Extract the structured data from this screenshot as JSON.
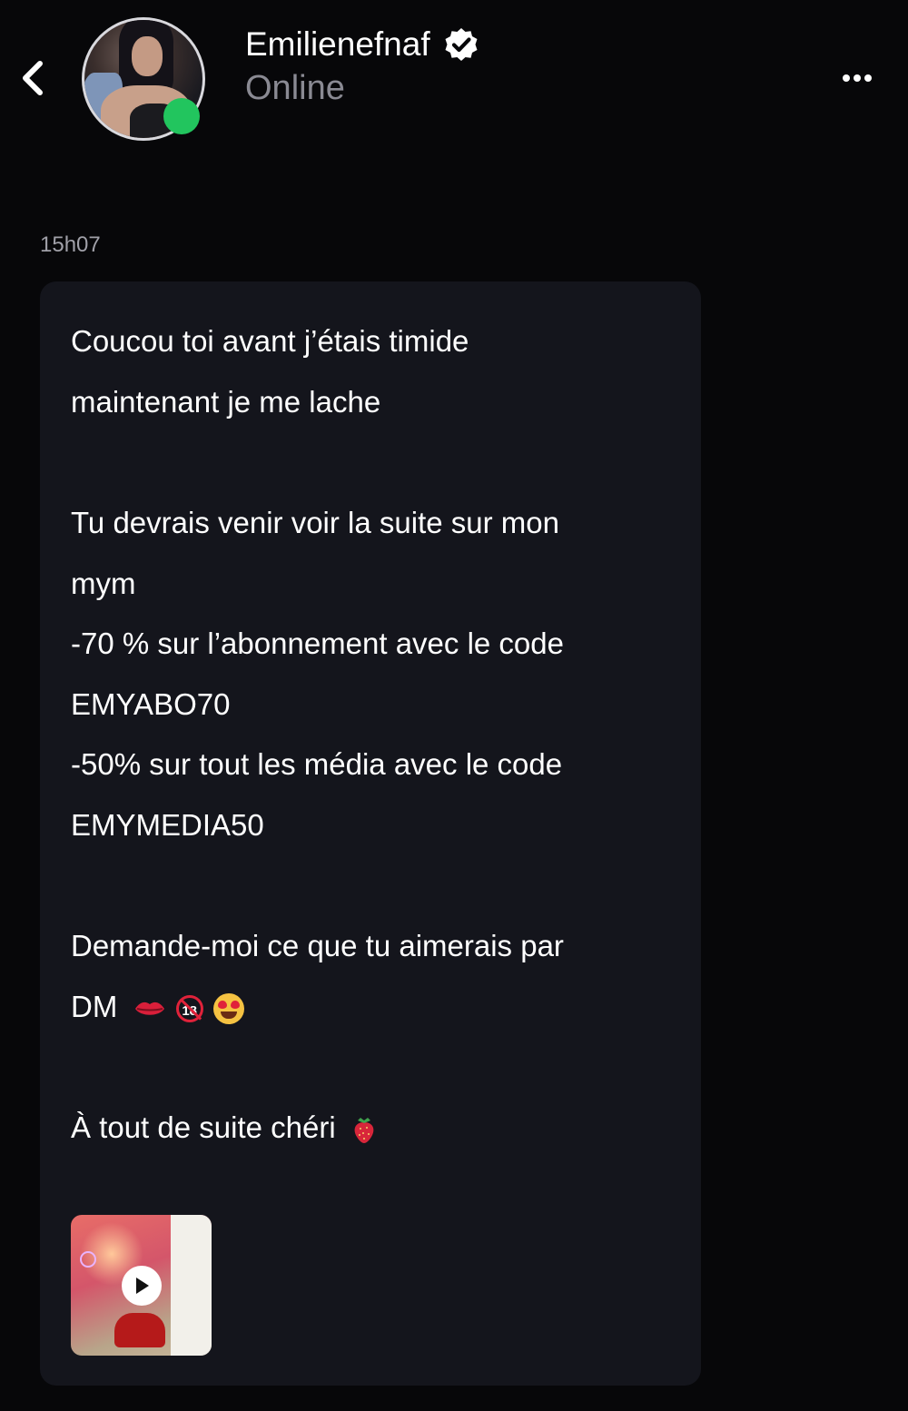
{
  "header": {
    "name": "Emilienefnaf",
    "status": "Online",
    "status_color": "#22c55e",
    "verified": true
  },
  "icons": {
    "back": "chevron-left-icon",
    "more": "more-horizontal-icon",
    "verified": "verified-badge-icon",
    "play": "play-icon"
  },
  "conversation": {
    "timestamp": "15h07",
    "message": {
      "lines": [
        "Coucou toi avant j’étais timide",
        "maintenant je me lache",
        "Tu devrais venir voir la suite sur mon",
        "mym",
        "-70 % sur l’abonnement avec le code",
        "EMYABO70",
        "-50% sur tout les média avec le code",
        "EMYMEDIA50",
        "Demande-moi ce que tu aimerais par",
        "DM",
        "À tout de suite chéri"
      ],
      "emojis": [
        "lips",
        "no-one-under-eighteen",
        "heart-eyes",
        "strawberry"
      ]
    },
    "attachment": {
      "type": "video",
      "no18_label": "18"
    }
  }
}
